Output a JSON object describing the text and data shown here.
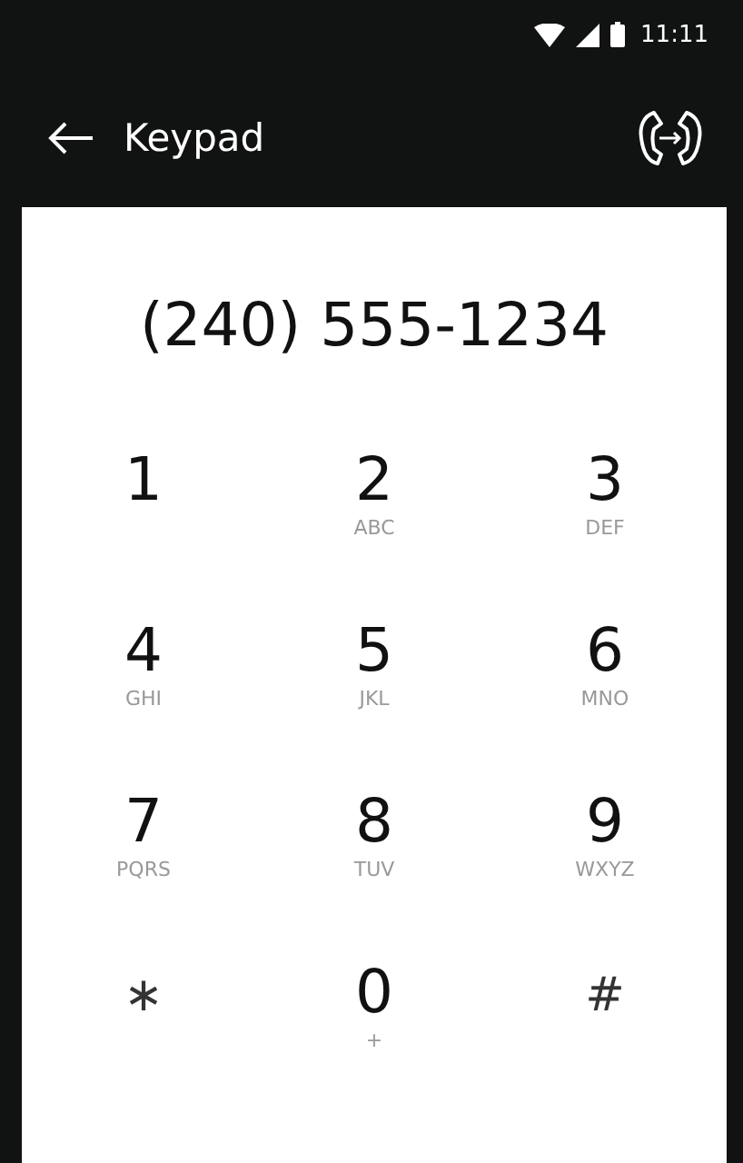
{
  "status_bar": {
    "time": "11:11"
  },
  "header": {
    "title": "Keypad"
  },
  "display": {
    "number": "(240) 555-1234"
  },
  "keys": [
    {
      "kind": "digit",
      "label": "1"
    },
    {
      "kind": "digit",
      "label": "2",
      "letters": "ABC"
    },
    {
      "kind": "digit",
      "label": "3",
      "letters": "DEF"
    },
    {
      "kind": "digit",
      "label": "4",
      "letters": "GHI"
    },
    {
      "kind": "digit",
      "label": "5",
      "letters": "JKL"
    },
    {
      "kind": "digit",
      "label": "6",
      "letters": "MNO"
    },
    {
      "kind": "digit",
      "label": "7",
      "letters": "PQRS"
    },
    {
      "kind": "digit",
      "label": "8",
      "letters": "TUV"
    },
    {
      "kind": "digit",
      "label": "9",
      "letters": "WXYZ"
    },
    {
      "kind": "symbol",
      "label": "∗"
    },
    {
      "kind": "digit",
      "label": "0",
      "letters": "+"
    },
    {
      "kind": "symbol",
      "label": "#"
    }
  ]
}
